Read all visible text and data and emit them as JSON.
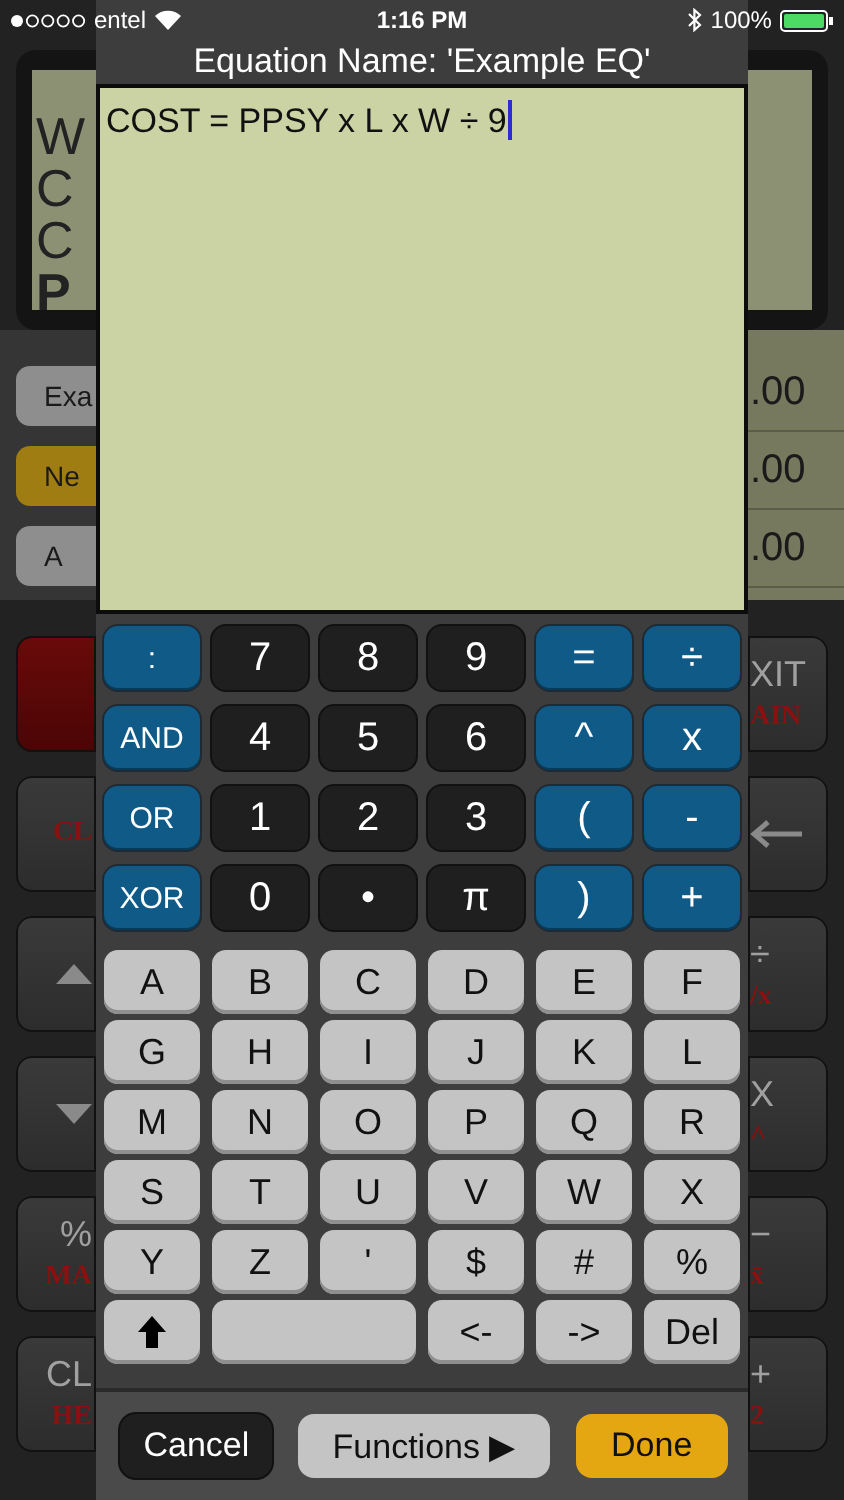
{
  "status_bar": {
    "carrier": "entel",
    "time": "1:16 PM",
    "battery": "100%"
  },
  "background": {
    "left_display": [
      {
        "text": "W",
        "bold": false
      },
      {
        "text": "C",
        "bold": false
      },
      {
        "text": "C",
        "bold": false
      },
      {
        "text": "P",
        "bold": true
      }
    ],
    "left_buttons": [
      {
        "label": "Exa",
        "color": "#8e8e8e"
      },
      {
        "label": "Ne",
        "color": "#a07d12"
      },
      {
        "label": "A",
        "color": "#8e8e8e"
      }
    ],
    "left_keys": [
      {
        "kind": "red"
      },
      {
        "kind": "key",
        "sub": "CL"
      },
      {
        "kind": "up"
      },
      {
        "kind": "down"
      },
      {
        "kind": "key",
        "label": "%",
        "sub": "MA"
      },
      {
        "kind": "key",
        "label": "CL",
        "sub": "HE"
      }
    ],
    "right_values": [
      ".00",
      ".00",
      ".00"
    ],
    "right_keys": [
      {
        "kind": "key",
        "label": "XIT",
        "sub": "AIN"
      },
      {
        "kind": "back"
      },
      {
        "kind": "key",
        "label": "÷",
        "sub": "/x"
      },
      {
        "kind": "key",
        "label": "X",
        "sub": "^"
      },
      {
        "kind": "key",
        "label": "−",
        "sub": "x̄"
      },
      {
        "kind": "key",
        "label": "+",
        "sub": "2"
      }
    ]
  },
  "dialog": {
    "title": "Equation Name: 'Example EQ'",
    "equation": "COST = PPSY x L x W ÷ 9",
    "keypad": [
      [
        {
          "label": ":",
          "kind": "op"
        },
        {
          "label": "7",
          "kind": "digit"
        },
        {
          "label": "8",
          "kind": "digit"
        },
        {
          "label": "9",
          "kind": "digit"
        },
        {
          "label": "=",
          "kind": "op"
        },
        {
          "label": "÷",
          "kind": "op"
        }
      ],
      [
        {
          "label": "AND",
          "kind": "op"
        },
        {
          "label": "4",
          "kind": "digit"
        },
        {
          "label": "5",
          "kind": "digit"
        },
        {
          "label": "6",
          "kind": "digit"
        },
        {
          "label": "^",
          "kind": "op"
        },
        {
          "label": "x",
          "kind": "op"
        }
      ],
      [
        {
          "label": "OR",
          "kind": "op"
        },
        {
          "label": "1",
          "kind": "digit"
        },
        {
          "label": "2",
          "kind": "digit"
        },
        {
          "label": "3",
          "kind": "digit"
        },
        {
          "label": "(",
          "kind": "op"
        },
        {
          "label": "-",
          "kind": "op"
        }
      ],
      [
        {
          "label": "XOR",
          "kind": "op"
        },
        {
          "label": "0",
          "kind": "digit"
        },
        {
          "label": "•",
          "kind": "digit"
        },
        {
          "label": "π",
          "kind": "digit"
        },
        {
          "label": ")",
          "kind": "op"
        },
        {
          "label": "+",
          "kind": "op"
        }
      ]
    ],
    "letters": [
      [
        {
          "label": "A",
          "kind": "letter"
        },
        {
          "label": "B",
          "kind": "letter"
        },
        {
          "label": "C",
          "kind": "letter"
        },
        {
          "label": "D",
          "kind": "letter"
        },
        {
          "label": "E",
          "kind": "letter"
        },
        {
          "label": "F",
          "kind": "letter"
        }
      ],
      [
        {
          "label": "G",
          "kind": "letter"
        },
        {
          "label": "H",
          "kind": "letter"
        },
        {
          "label": "I",
          "kind": "letter"
        },
        {
          "label": "J",
          "kind": "letter"
        },
        {
          "label": "K",
          "kind": "letter"
        },
        {
          "label": "L",
          "kind": "letter"
        }
      ],
      [
        {
          "label": "M",
          "kind": "letter"
        },
        {
          "label": "N",
          "kind": "letter"
        },
        {
          "label": "O",
          "kind": "letter"
        },
        {
          "label": "P",
          "kind": "letter"
        },
        {
          "label": "Q",
          "kind": "letter"
        },
        {
          "label": "R",
          "kind": "letter"
        }
      ],
      [
        {
          "label": "S",
          "kind": "letter"
        },
        {
          "label": "T",
          "kind": "letter"
        },
        {
          "label": "U",
          "kind": "letter"
        },
        {
          "label": "V",
          "kind": "letter"
        },
        {
          "label": "W",
          "kind": "letter"
        },
        {
          "label": "X",
          "kind": "letter"
        }
      ],
      [
        {
          "label": "Y",
          "kind": "letter"
        },
        {
          "label": "Z",
          "kind": "letter"
        },
        {
          "label": "'",
          "kind": "letter"
        },
        {
          "label": "$",
          "kind": "letter"
        },
        {
          "label": "#",
          "kind": "letter"
        },
        {
          "label": "%",
          "kind": "letter"
        }
      ],
      [
        {
          "kind": "shift"
        },
        {
          "kind": "space"
        },
        {
          "label": "<-",
          "kind": "letter"
        },
        {
          "label": "->",
          "kind": "letter"
        },
        {
          "label": "Del",
          "kind": "letter"
        }
      ]
    ],
    "buttons": [
      {
        "label": "Cancel",
        "kind": "cancel"
      },
      {
        "label": "Functions ▶",
        "kind": "functions"
      },
      {
        "label": "Done",
        "kind": "done"
      }
    ]
  }
}
